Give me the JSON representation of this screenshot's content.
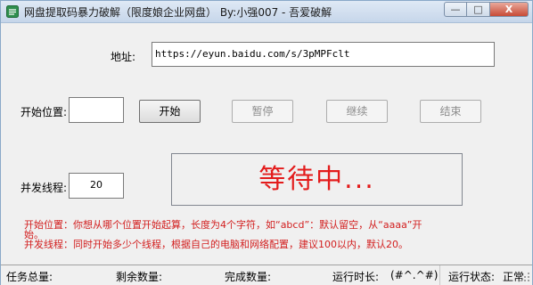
{
  "title": "网盘提取码暴力破解（限度娘企业网盘） By:小强007 - 吾爱破解",
  "window_controls": {
    "minimize": "—",
    "maximize": "□",
    "close": "X"
  },
  "url_label": "地址:",
  "url_value": "https://eyun.baidu.com/s/3pMPFclt",
  "start_pos_label": "开始位置:",
  "start_pos_value": "",
  "buttons": {
    "start": "开始",
    "pause": "暂停",
    "resume": "继续",
    "stop": "结束"
  },
  "threads_label": "并发线程:",
  "threads_value": "20",
  "status_text": "等待中...",
  "help": {
    "line1": "开始位置：你想从哪个位置开始起算，长度为4个字符，如“abcd”：默认留空，从“aaaa”开",
    "line1b": "始。",
    "line2": "并发线程：同时开始多少个线程，根据自己的电脑和网络配置，建议100以内，默认20。"
  },
  "statusbar": {
    "total_label": "任务总量:",
    "total_value": "",
    "remaining_label": "剩余数量:",
    "remaining_value": "",
    "done_label": "完成数量:",
    "done_value": "",
    "runtime_label": "运行时长:",
    "runtime_value": "(#^.^#)",
    "state_label": "运行状态:",
    "state_value": "正常"
  }
}
